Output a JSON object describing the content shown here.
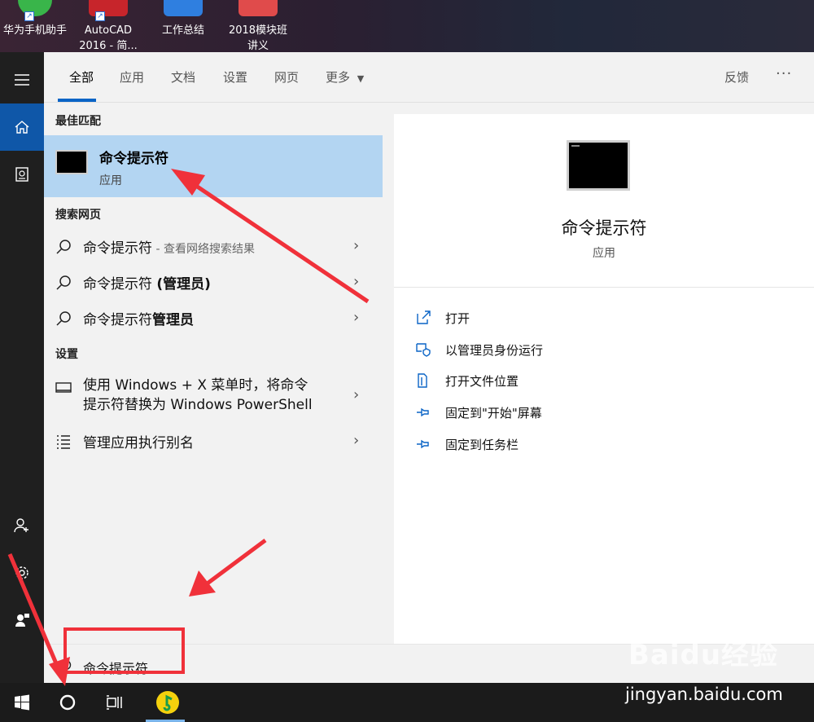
{
  "desktop": {
    "icons": [
      {
        "label_line1": "华为手机助手",
        "label_line2": ""
      },
      {
        "label_line1": "AutoCAD",
        "label_line2": "2016 - 简..."
      },
      {
        "label_line1": "工作总结",
        "label_line2": ""
      },
      {
        "label_line1": "2018模块班",
        "label_line2": "讲义"
      }
    ]
  },
  "tabs": {
    "all": "全部",
    "apps": "应用",
    "docs": "文档",
    "settings": "设置",
    "web": "网页",
    "more": "更多",
    "feedback": "反馈",
    "overflow": "···"
  },
  "results": {
    "best_match_header": "最佳匹配",
    "best_match": {
      "title": "命令提示符",
      "subtitle": "应用"
    },
    "web_header": "搜索网页",
    "web_items": [
      {
        "main": "命令提示符",
        "suffix": " - 查看网络搜索结果"
      },
      {
        "main": "命令提示符 ",
        "suffix": "(管理员)"
      },
      {
        "main": "命令提示符",
        "suffix": "管理员"
      }
    ],
    "settings_header": "设置",
    "settings_items": [
      {
        "line1": "使用 Windows + X 菜单时，将命令",
        "line2": "提示符替换为 Windows PowerShell"
      },
      {
        "line1": "管理应用执行别名",
        "line2": ""
      }
    ]
  },
  "preview": {
    "title": "命令提示符",
    "subtitle": "应用",
    "actions": [
      "打开",
      "以管理员身份运行",
      "打开文件位置",
      "固定到\"开始\"屏幕",
      "固定到任务栏"
    ]
  },
  "search": {
    "query": "命令提示符"
  },
  "watermark": {
    "logo": "Baidu经验",
    "url": "jingyan.baidu.com"
  },
  "colors": {
    "accent": "#0a64c6",
    "selection": "#b3d5f2",
    "annotation": "#f0313a"
  }
}
